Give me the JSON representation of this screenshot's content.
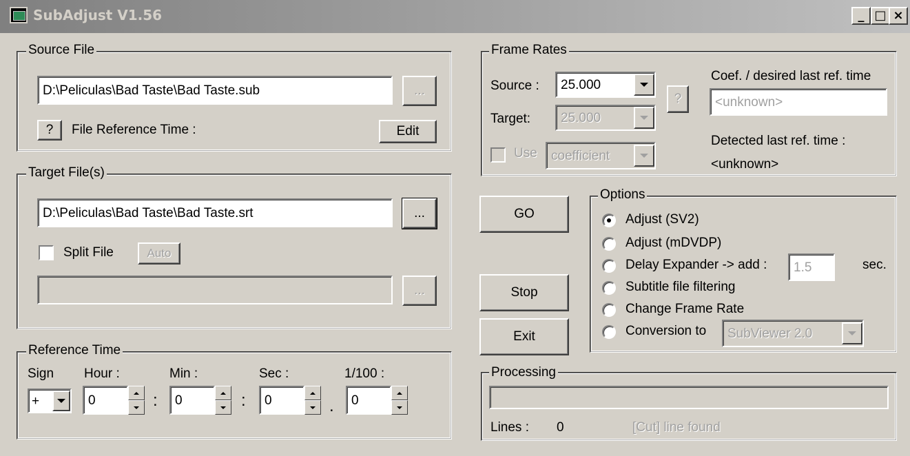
{
  "window": {
    "title": "SubAdjust V1.56",
    "minimize": "_",
    "maximize": "□",
    "close": "×"
  },
  "source_file": {
    "legend": "Source File",
    "path": "D:\\Peliculas\\Bad Taste\\Bad Taste.sub",
    "browse_label": "...",
    "help_label": "?",
    "ref_time_label": "File Reference Time :",
    "edit_label": "Edit"
  },
  "target_files": {
    "legend": "Target File(s)",
    "path": "D:\\Peliculas\\Bad Taste\\Bad Taste.srt",
    "browse_label": "...",
    "split_label": "Split File",
    "split_checked": false,
    "auto_label": "Auto",
    "split_path": "",
    "split_browse_label": "..."
  },
  "reference_time": {
    "legend": "Reference Time",
    "sign_label": "Sign",
    "hour_label": "Hour :",
    "min_label": "Min :",
    "sec_label": "Sec :",
    "hundredths_label": "1/100 :",
    "sign_value": "+",
    "hour": "0",
    "min": "0",
    "sec": "0",
    "hundredths": "0",
    "sep1": ":",
    "sep2": ":",
    "sep3": "."
  },
  "frame_rates": {
    "legend": "Frame Rates",
    "source_label": "Source :",
    "source_value": "25.000",
    "target_label": "Target:",
    "target_value": "25.000",
    "help_label": "?",
    "use_label": "Use",
    "use_mode": "coefficient",
    "coef_label": "Coef. / desired last ref. time",
    "coef_value": "<unknown>",
    "detected_label": "Detected last ref. time :",
    "detected_value": "<unknown>"
  },
  "actions": {
    "go": "GO",
    "stop": "Stop",
    "exit": "Exit"
  },
  "options": {
    "legend": "Options",
    "selected": 0,
    "items": [
      "Adjust (SV2)",
      "Adjust (mDVDP)",
      "Delay Expander -> add :",
      "Subtitle file filtering",
      "Change Frame Rate",
      "Conversion to"
    ],
    "delay_value": "1.5",
    "delay_unit": "sec.",
    "conversion_value": "SubViewer 2.0"
  },
  "processing": {
    "legend": "Processing",
    "progress": 0,
    "lines_label": "Lines :",
    "lines_value": "0",
    "cut_label": "[Cut] line found"
  }
}
